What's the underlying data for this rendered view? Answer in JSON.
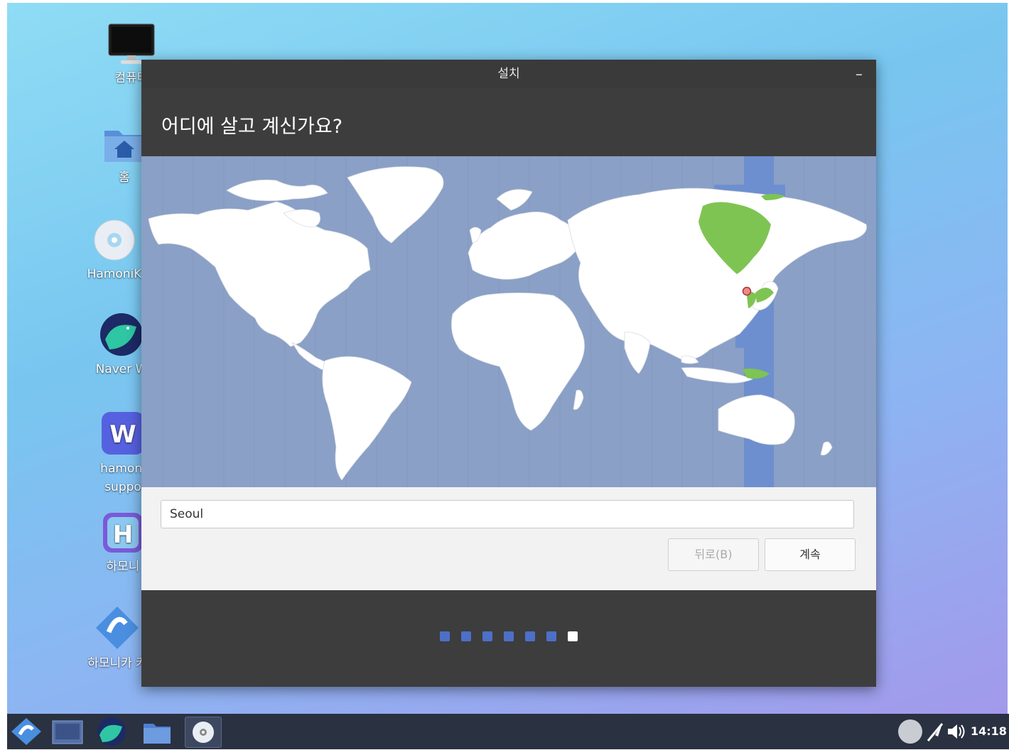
{
  "desktop": {
    "icons": [
      {
        "label": "컴퓨터",
        "icon": "monitor-icon"
      },
      {
        "label": "홈",
        "icon": "home-folder-icon"
      },
      {
        "label": "HamoniK",
        "icon": "disc-icon"
      },
      {
        "label": "Naver W",
        "icon": "naver-whale-icon"
      },
      {
        "label": "hamoni",
        "label2": "suppo",
        "icon": "hamonikr-support-icon"
      },
      {
        "label": "하모니",
        "icon": "hamonikr-h-icon"
      },
      {
        "label": "하모니카 커",
        "icon": "hamonikr-community-icon"
      }
    ]
  },
  "window": {
    "title": "설치",
    "minimize_label": "–",
    "question": "어디에 살고 계신가요?"
  },
  "timezone": {
    "value": "Seoul",
    "selected_city": "Seoul"
  },
  "buttons": {
    "back": "뒤로(B)",
    "continue": "계속"
  },
  "progress": {
    "total_steps": 7,
    "current_step": 7
  },
  "taskbar": {
    "items": [
      "hamonikr-menu-icon",
      "show-desktop-icon",
      "naver-whale-icon",
      "file-manager-icon",
      "installer-disc-icon"
    ],
    "clock": "14:18"
  },
  "colors": {
    "map_ocean": "#8aa0c6",
    "timezone_band": "#6d8fcf",
    "selected_region": "#7ec453",
    "progress_dot": "#4e6fc8",
    "window_bg": "#3d3d3d"
  }
}
